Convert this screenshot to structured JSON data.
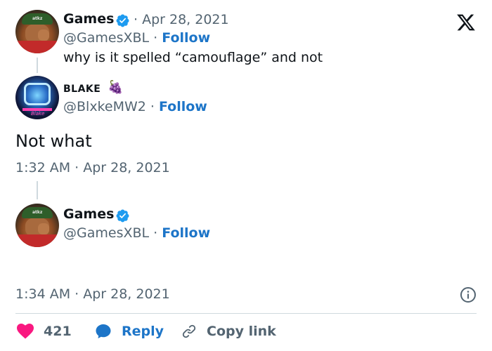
{
  "tweet1": {
    "name": "Games",
    "date": "· Apr 28, 2021",
    "handle": "@GamesXBL ·",
    "follow": "Follow",
    "text": "why is it spelled “camouflage” and not",
    "cap_text": "atkz"
  },
  "tweet2": {
    "name": "BLAKE",
    "emoji": "🍇",
    "handle": "@BlxkeMW2 ·",
    "follow": "Follow",
    "body": "Not what",
    "timestamp": "1:32 AM · Apr 28, 2021",
    "avatar_signature": "Blake"
  },
  "tweet3": {
    "name": "Games",
    "handle": "@GamesXBL ·",
    "follow": "Follow",
    "timestamp": "1:34 AM · Apr 28, 2021",
    "cap_text": "atkz"
  },
  "actions": {
    "likes": "421",
    "reply": "Reply",
    "copy_link": "Copy link"
  },
  "icons": {
    "logo": "x-logo-icon",
    "verified": "verified-badge-icon",
    "info": "info-icon",
    "like": "heart-icon",
    "reply": "reply-bubble-icon",
    "link": "link-icon"
  },
  "colors": {
    "accent": "#1d9bf0",
    "follow": "#1d75c8",
    "heart": "#f91880",
    "secondary_text": "#536471"
  }
}
